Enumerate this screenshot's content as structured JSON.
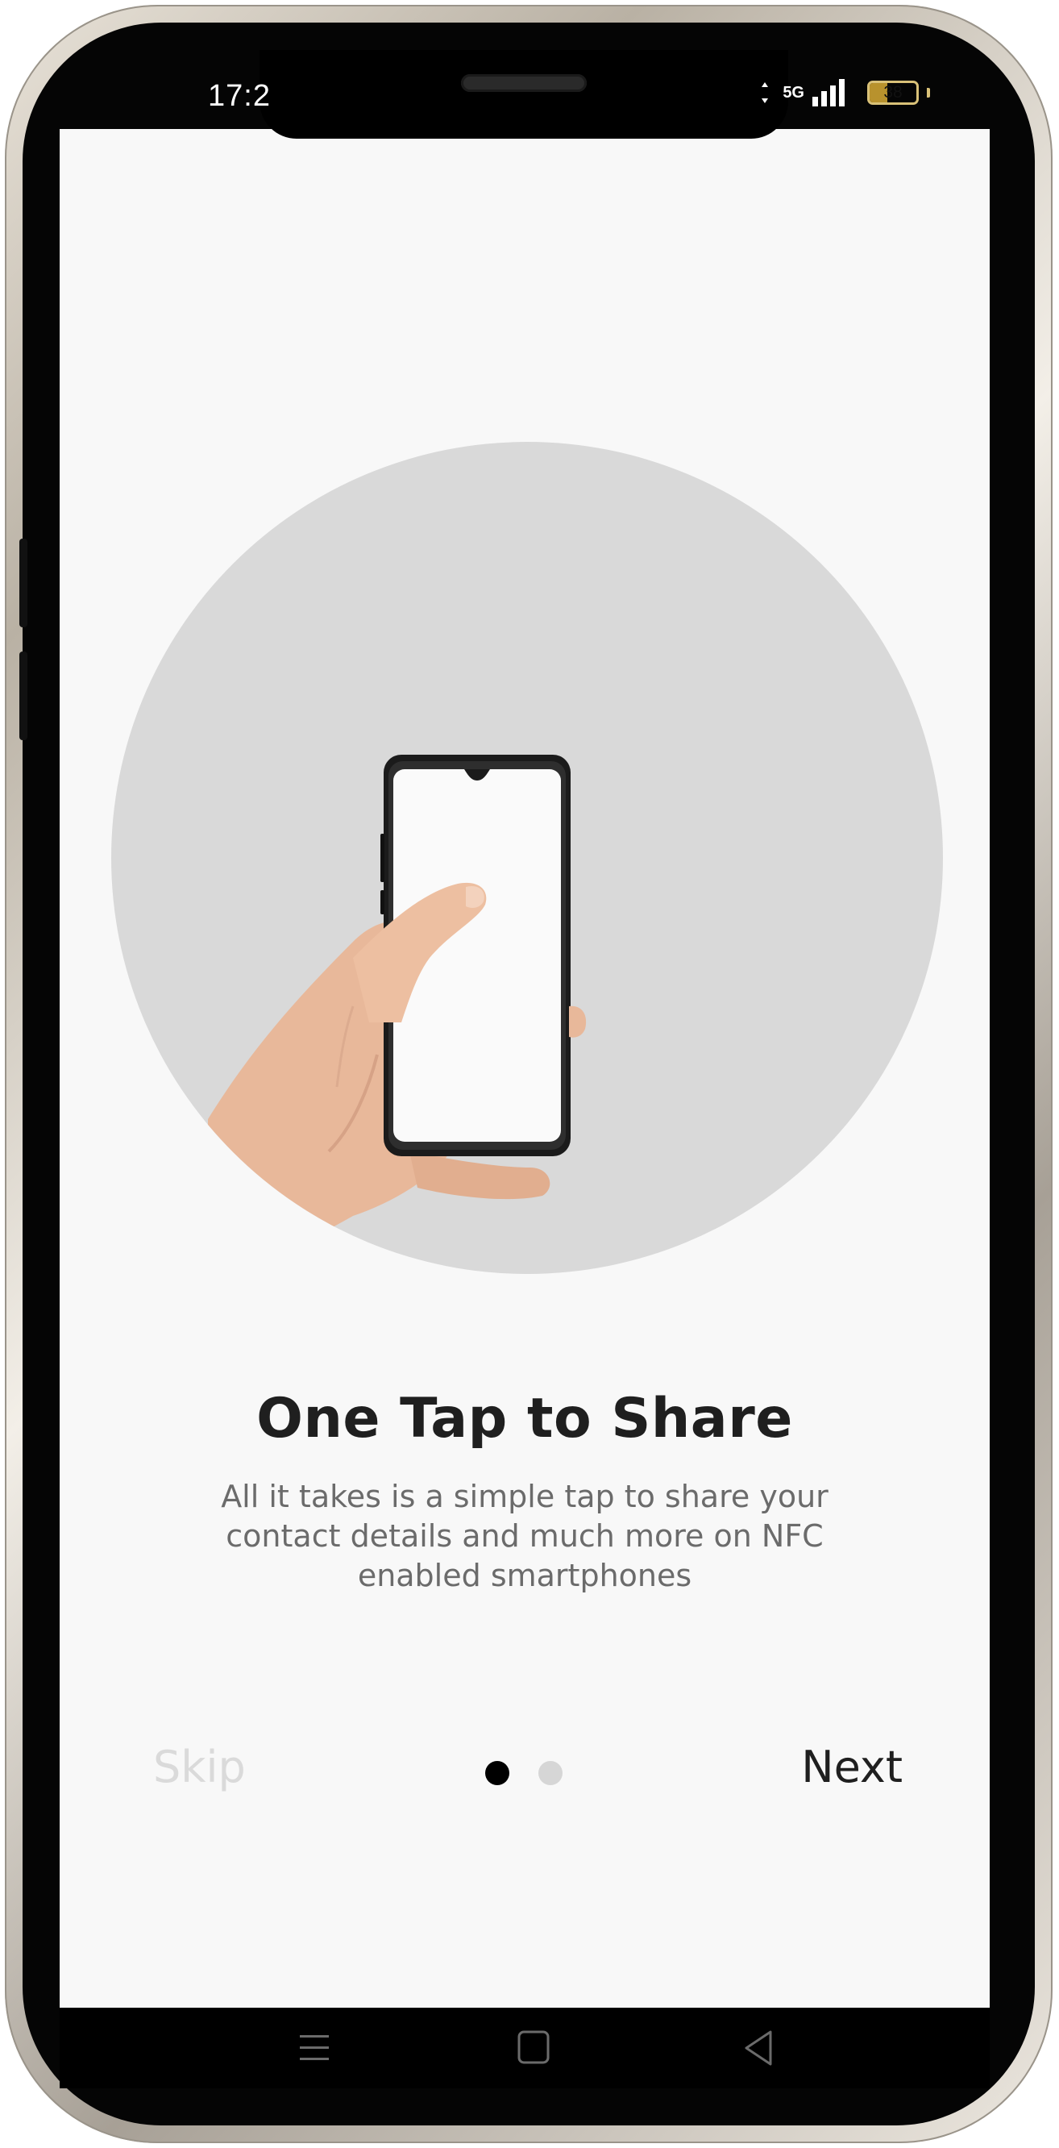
{
  "status_bar": {
    "time": "17:2",
    "network_label": "5G",
    "battery_level": "38",
    "battery_fraction": 0.38
  },
  "onboarding": {
    "title": "One Tap to Share",
    "description": "All it takes is a simple tap to share your contact details and much more on NFC enabled smartphones",
    "skip_label": "Skip",
    "next_label": "Next",
    "page_count": 2,
    "current_page": 1
  },
  "icons": {
    "hero": "hand-holding-phone-illustration",
    "nav_menu": "menu-lines-icon",
    "nav_home": "square-home-icon",
    "nav_back": "triangle-back-icon"
  },
  "colors": {
    "screen_background": "#f8f8f8",
    "circle": "#d9d9d9",
    "title": "#1f1f1f",
    "subtitle": "#6b6b6b",
    "skip": "#dadada",
    "dot_active": "#000000",
    "dot_inactive": "#d6d6d6"
  }
}
